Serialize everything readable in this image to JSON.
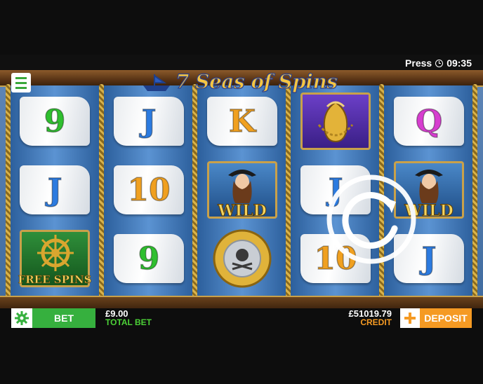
{
  "status": {
    "press_label": "Press",
    "time": "09:35"
  },
  "game": {
    "title": "7 Seas of Spins",
    "wild_label": "WILD",
    "free_spins_label": "FREE SPINS"
  },
  "reels": [
    [
      "9",
      "J",
      "free-spins-wheel"
    ],
    [
      "J",
      "10",
      "9"
    ],
    [
      "K",
      "wild-pirate",
      "pirate-coin"
    ],
    [
      "treasure-sack",
      "J",
      "10"
    ],
    [
      "Q",
      "wild-pirate",
      "J"
    ]
  ],
  "footer": {
    "bet_label": "BET",
    "total_bet_value": "£9.00",
    "total_bet_label": "TOTAL BET",
    "credit_value": "£51019.79",
    "credit_label": "CREDIT",
    "deposit_label": "DEPOSIT"
  },
  "colors": {
    "bet_green": "#36b03e",
    "deposit_orange": "#f59a23",
    "credit_orange": "#f59a23",
    "total_bet_green": "#4cd137"
  },
  "icons": [
    "menu-icon",
    "clock-icon",
    "settings-gear-icon",
    "plus-icon",
    "spin-refresh-icon"
  ]
}
